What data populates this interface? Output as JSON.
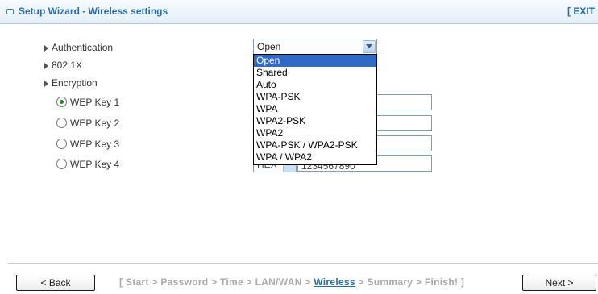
{
  "header": {
    "title": "Setup Wizard - Wireless settings",
    "exit_label": "[ EXIT"
  },
  "form": {
    "authentication_label": "Authentication",
    "dot1x_label": "802.1X",
    "encryption_label": "Encryption",
    "authentication_value": "Open",
    "authentication_options": [
      "Open",
      "Shared",
      "Auto",
      "WPA-PSK",
      "WPA",
      "WPA2-PSK",
      "WPA2",
      "WPA-PSK / WPA2-PSK",
      "WPA / WPA2"
    ],
    "wep_keys": [
      {
        "label": "WEP Key  1",
        "checked": true
      },
      {
        "label": "WEP Key  2",
        "checked": false
      },
      {
        "label": "WEP Key  3",
        "checked": false
      },
      {
        "label": "WEP Key  4",
        "checked": false
      }
    ],
    "key4_type_partial": "HEX",
    "key4_value_partial": "1234567890"
  },
  "footer": {
    "back_label": "< Back",
    "next_label": "Next >",
    "steps_prefix": "[ Start > Password > Time > LAN/WAN > ",
    "steps_active": "Wireless",
    "steps_suffix": " > Summary > Finish! ]"
  }
}
